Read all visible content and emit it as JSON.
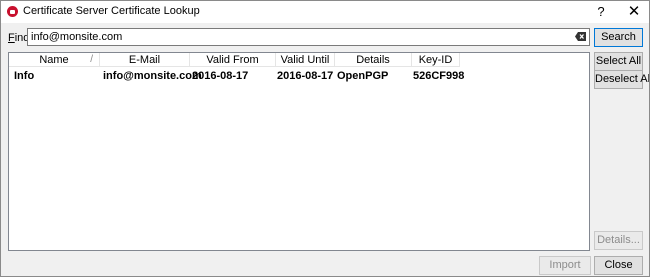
{
  "window": {
    "title": "Certificate Server Certificate Lookup",
    "help_glyph": "?",
    "close_glyph": "✕"
  },
  "find": {
    "label_mnemonic": "F",
    "label_rest": "ind:",
    "value": "info@monsite.com"
  },
  "buttons": {
    "search": "Search",
    "select_all": "Select All",
    "deselect_all": "Deselect All",
    "details": "Details...",
    "import": "Import",
    "close": "Close"
  },
  "table": {
    "columns": [
      "Name",
      "E-Mail",
      "Valid From",
      "Valid Until",
      "Details",
      "Key-ID"
    ],
    "sort_indicator": "/",
    "rows": [
      [
        "Info",
        "info@monsite.com",
        "2016-08-17",
        "2016-08-17",
        "OpenPGP",
        "526CF998"
      ]
    ]
  }
}
